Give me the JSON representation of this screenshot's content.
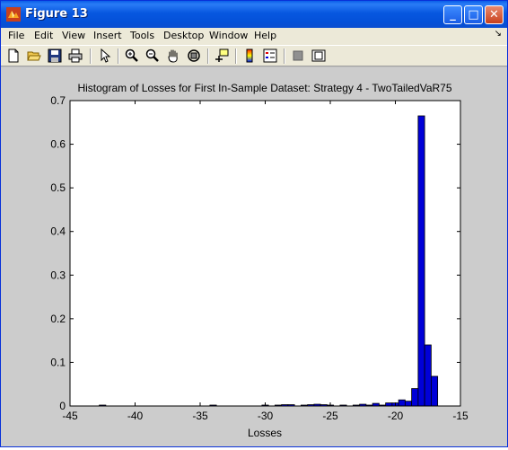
{
  "window": {
    "title": "Figure 13",
    "buttons": {
      "minimize": "_",
      "maximize": "□",
      "close": "✕"
    }
  },
  "menu": {
    "items": [
      "File",
      "Edit",
      "View",
      "Insert",
      "Tools",
      "Desktop",
      "Window",
      "Help"
    ],
    "overflow_icon": "chevron-icon"
  },
  "toolbar": {
    "icons": [
      "new-figure-icon",
      "open-file-icon",
      "save-icon",
      "print-icon",
      "edit-plot-arrow-icon",
      "zoom-in-icon",
      "zoom-out-icon",
      "pan-hand-icon",
      "rotate-3d-icon",
      "data-cursor-icon",
      "colorbar-icon",
      "legend-icon",
      "hide-plot-tools-icon",
      "show-plot-tools-icon"
    ]
  },
  "colors": {
    "bar_fill": "#0000d8",
    "bar_edge": "#000000",
    "figure_bg": "#cccccc",
    "axes_bg": "#ffffff"
  },
  "chart_data": {
    "type": "bar",
    "title": "Histogram of Losses for First In-Sample Dataset: Strategy 4 - TwoTailedVaR75",
    "xlabel": "Losses",
    "ylabel": "",
    "xlim": [
      -45,
      -15
    ],
    "ylim": [
      0,
      0.7
    ],
    "grid": false,
    "xticks": [
      "-45",
      "-40",
      "-35",
      "-30",
      "-25",
      "-20",
      "-15"
    ],
    "yticks": [
      "0",
      "0.1",
      "0.2",
      "0.3",
      "0.4",
      "0.5",
      "0.6",
      "0.7"
    ],
    "bin_width": 0.5,
    "bins": [
      {
        "x": -42.5,
        "y": 0.0015
      },
      {
        "x": -34.0,
        "y": 0.0015
      },
      {
        "x": -30.0,
        "y": 0.0015
      },
      {
        "x": -29.0,
        "y": 0.002
      },
      {
        "x": -28.5,
        "y": 0.003
      },
      {
        "x": -28.0,
        "y": 0.003
      },
      {
        "x": -27.0,
        "y": 0.002
      },
      {
        "x": -26.5,
        "y": 0.003
      },
      {
        "x": -26.0,
        "y": 0.004
      },
      {
        "x": -25.5,
        "y": 0.003
      },
      {
        "x": -25.0,
        "y": 0.002
      },
      {
        "x": -24.0,
        "y": 0.002
      },
      {
        "x": -23.0,
        "y": 0.002
      },
      {
        "x": -22.5,
        "y": 0.004
      },
      {
        "x": -22.0,
        "y": 0.002
      },
      {
        "x": -21.5,
        "y": 0.006
      },
      {
        "x": -21.0,
        "y": 0.002
      },
      {
        "x": -20.5,
        "y": 0.007
      },
      {
        "x": -20.0,
        "y": 0.007
      },
      {
        "x": -19.5,
        "y": 0.014
      },
      {
        "x": -19.0,
        "y": 0.011
      },
      {
        "x": -18.5,
        "y": 0.04
      },
      {
        "x": -18.0,
        "y": 0.665
      },
      {
        "x": -17.5,
        "y": 0.14
      },
      {
        "x": -17.0,
        "y": 0.068
      }
    ]
  }
}
